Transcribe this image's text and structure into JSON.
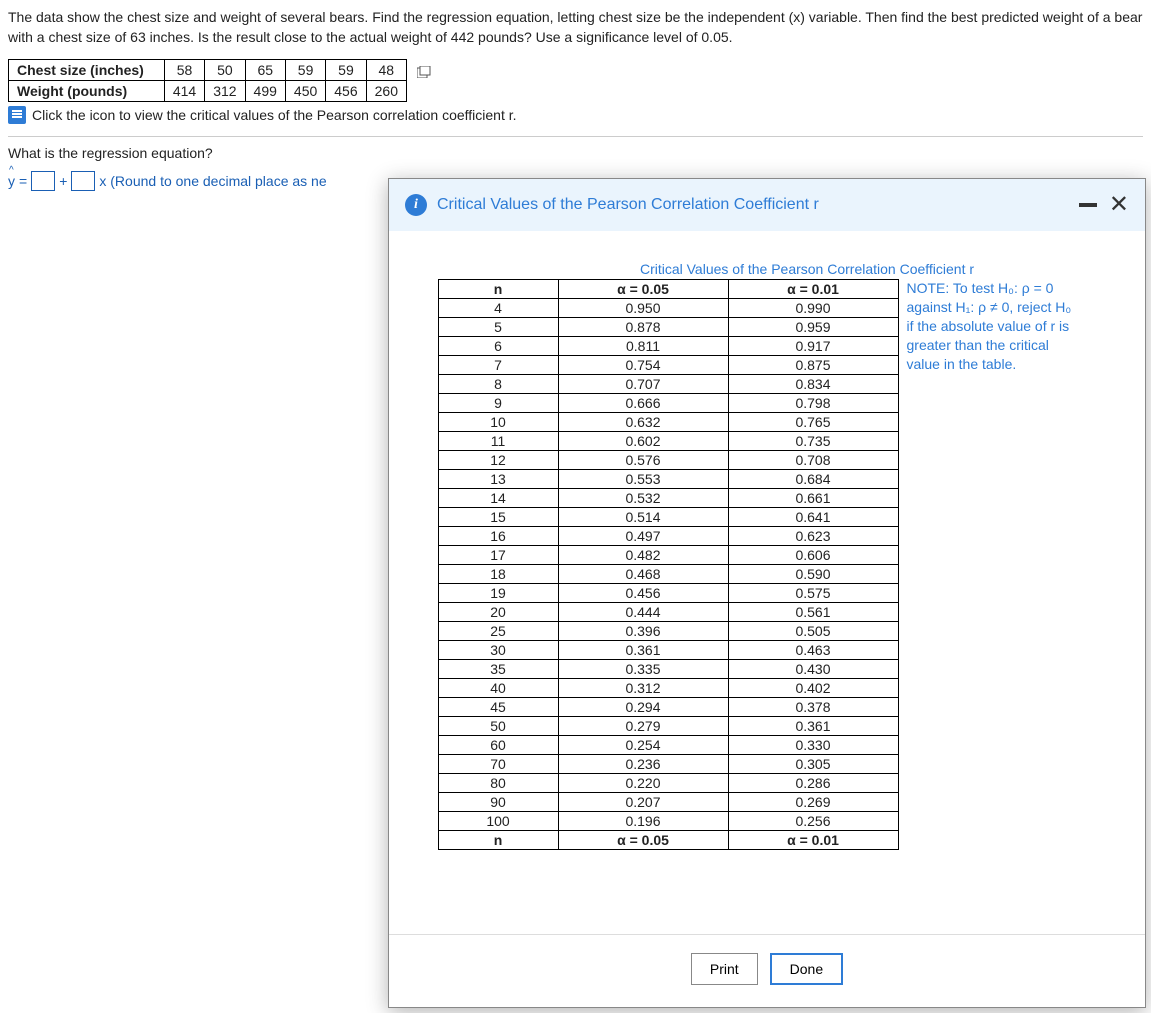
{
  "problem": {
    "text": "The data show the chest size and weight of several bears. Find the regression equation, letting chest size be the independent (x) variable. Then find the best predicted weight of a bear with a chest size of 63 inches. Is the result close to the actual weight of 442 pounds? Use a significance level of 0.05."
  },
  "data_table": {
    "row1_label": "Chest size (inches)",
    "row2_label": "Weight (pounds)",
    "chest": [
      "58",
      "50",
      "65",
      "59",
      "59",
      "48"
    ],
    "weight": [
      "414",
      "312",
      "499",
      "450",
      "456",
      "260"
    ]
  },
  "link_text": "Click the icon to view the critical values of the Pearson correlation coefficient r.",
  "question": "What is the regression equation?",
  "equation": {
    "y": "y",
    "eq": "=",
    "plus": "+",
    "x_suffix": "x (Round to one decimal place as ne"
  },
  "dialog": {
    "title": "Critical Values of the Pearson Correlation Coefficient r",
    "table_title": "Critical Values of the Pearson Correlation Coefficient r",
    "headers": {
      "n": "n",
      "a05": "α = 0.05",
      "a01": "α = 0.01"
    },
    "rows": [
      {
        "n": "4",
        "a05": "0.950",
        "a01": "0.990"
      },
      {
        "n": "5",
        "a05": "0.878",
        "a01": "0.959"
      },
      {
        "n": "6",
        "a05": "0.811",
        "a01": "0.917"
      },
      {
        "n": "7",
        "a05": "0.754",
        "a01": "0.875"
      },
      {
        "n": "8",
        "a05": "0.707",
        "a01": "0.834"
      },
      {
        "n": "9",
        "a05": "0.666",
        "a01": "0.798"
      },
      {
        "n": "10",
        "a05": "0.632",
        "a01": "0.765"
      },
      {
        "n": "11",
        "a05": "0.602",
        "a01": "0.735"
      },
      {
        "n": "12",
        "a05": "0.576",
        "a01": "0.708"
      },
      {
        "n": "13",
        "a05": "0.553",
        "a01": "0.684"
      },
      {
        "n": "14",
        "a05": "0.532",
        "a01": "0.661"
      },
      {
        "n": "15",
        "a05": "0.514",
        "a01": "0.641"
      },
      {
        "n": "16",
        "a05": "0.497",
        "a01": "0.623"
      },
      {
        "n": "17",
        "a05": "0.482",
        "a01": "0.606"
      },
      {
        "n": "18",
        "a05": "0.468",
        "a01": "0.590"
      },
      {
        "n": "19",
        "a05": "0.456",
        "a01": "0.575"
      },
      {
        "n": "20",
        "a05": "0.444",
        "a01": "0.561"
      },
      {
        "n": "25",
        "a05": "0.396",
        "a01": "0.505"
      },
      {
        "n": "30",
        "a05": "0.361",
        "a01": "0.463"
      },
      {
        "n": "35",
        "a05": "0.335",
        "a01": "0.430"
      },
      {
        "n": "40",
        "a05": "0.312",
        "a01": "0.402"
      },
      {
        "n": "45",
        "a05": "0.294",
        "a01": "0.378"
      },
      {
        "n": "50",
        "a05": "0.279",
        "a01": "0.361"
      },
      {
        "n": "60",
        "a05": "0.254",
        "a01": "0.330"
      },
      {
        "n": "70",
        "a05": "0.236",
        "a01": "0.305"
      },
      {
        "n": "80",
        "a05": "0.220",
        "a01": "0.286"
      },
      {
        "n": "90",
        "a05": "0.207",
        "a01": "0.269"
      },
      {
        "n": "100",
        "a05": "0.196",
        "a01": "0.256"
      }
    ],
    "note_lines": [
      "NOTE: To test H₀: ρ = 0",
      "against H₁: ρ ≠ 0, reject H₀",
      "if the absolute value of r is",
      "greater than the critical",
      "value in the table."
    ],
    "print": "Print",
    "done": "Done"
  }
}
